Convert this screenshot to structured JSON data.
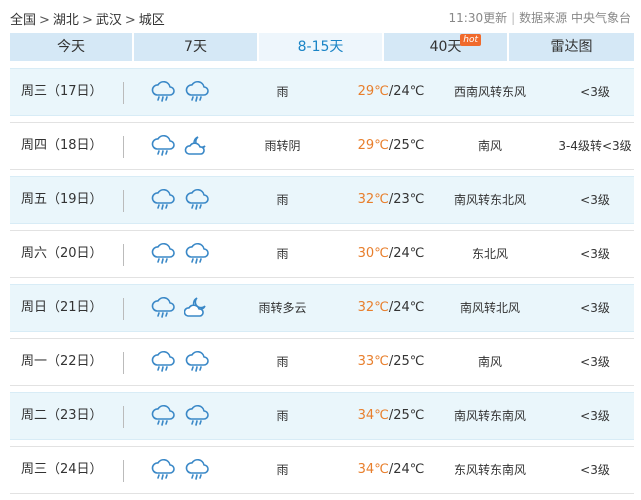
{
  "breadcrumb": {
    "items": [
      "全国",
      "湖北",
      "武汉",
      "城区"
    ],
    "separator": ">"
  },
  "source": {
    "update_time": "11:30更新",
    "label": "数据来源",
    "agency": "中央气象台"
  },
  "tabs": [
    {
      "label": "今天",
      "active": false
    },
    {
      "label": "7天",
      "active": false
    },
    {
      "label": "8-15天",
      "active": true
    },
    {
      "label": "40天",
      "active": false,
      "badge": "hot"
    },
    {
      "label": "雷达图",
      "active": false
    }
  ],
  "colors": {
    "high_temp": "#e87e2b",
    "active_tab": "#1a84c6",
    "tab_bg": "#d5e8f6",
    "row_bg": "#eaf6fb"
  },
  "forecast": [
    {
      "date": "周三（17日）",
      "icon_day": "rain-icon",
      "icon_night": "rain-icon",
      "desc": "雨",
      "high": "29℃",
      "low": "/24℃",
      "wind": "西南风转东风",
      "level": "<3级"
    },
    {
      "date": "周四（18日）",
      "icon_day": "rain-icon",
      "icon_night": "overcast-moon-icon",
      "desc": "雨转阴",
      "high": "29℃",
      "low": "/25℃",
      "wind": "南风",
      "level": "3-4级转<3级"
    },
    {
      "date": "周五（19日）",
      "icon_day": "rain-icon",
      "icon_night": "rain-icon",
      "desc": "雨",
      "high": "32℃",
      "low": "/23℃",
      "wind": "南风转东北风",
      "level": "<3级"
    },
    {
      "date": "周六（20日）",
      "icon_day": "rain-icon",
      "icon_night": "rain-icon",
      "desc": "雨",
      "high": "30℃",
      "low": "/24℃",
      "wind": "东北风",
      "level": "<3级"
    },
    {
      "date": "周日（21日）",
      "icon_day": "rain-icon",
      "icon_night": "cloudy-moon-icon",
      "desc": "雨转多云",
      "high": "32℃",
      "low": "/24℃",
      "wind": "南风转北风",
      "level": "<3级"
    },
    {
      "date": "周一（22日）",
      "icon_day": "rain-icon",
      "icon_night": "rain-icon",
      "desc": "雨",
      "high": "33℃",
      "low": "/25℃",
      "wind": "南风",
      "level": "<3级"
    },
    {
      "date": "周二（23日）",
      "icon_day": "rain-icon",
      "icon_night": "rain-icon",
      "desc": "雨",
      "high": "34℃",
      "low": "/25℃",
      "wind": "南风转东南风",
      "level": "<3级"
    },
    {
      "date": "周三（24日）",
      "icon_day": "rain-icon",
      "icon_night": "rain-icon",
      "desc": "雨",
      "high": "34℃",
      "low": "/24℃",
      "wind": "东风转东南风",
      "level": "<3级"
    }
  ]
}
